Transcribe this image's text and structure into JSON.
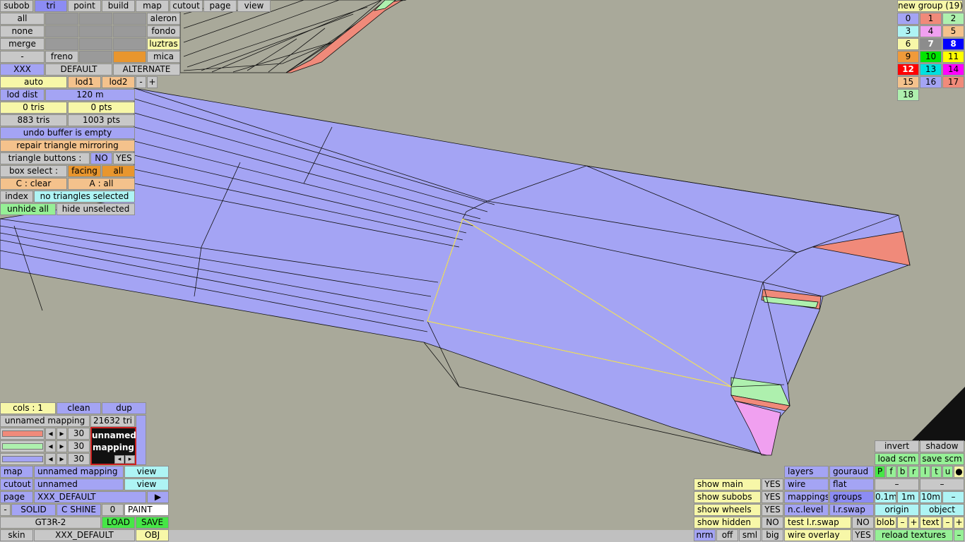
{
  "modes": {
    "subob": "subob",
    "tri": "tri",
    "point": "point",
    "build": "build",
    "map": "map",
    "cutout": "cutout",
    "page": "page",
    "view": "view"
  },
  "subob_panel": {
    "all": "all",
    "none": "none",
    "merge": "merge",
    "dash": "-",
    "aleron": "aleron",
    "fondo": "fondo",
    "luztras": "luztras",
    "freno": "freno",
    "mica": "mica",
    "xxx": "XXX",
    "default": "DEFAULT",
    "alternate": "ALTERNATE"
  },
  "lod": {
    "auto": "auto",
    "lod1": "lod1",
    "lod2": "lod2",
    "minus": "-",
    "plus": "+",
    "dist_label": "lod dist",
    "dist_value": "120 m"
  },
  "stats": {
    "sel_tris": "0 tris",
    "sel_pts": "0 pts",
    "tris": "883 tris",
    "pts": "1003 pts"
  },
  "messages": {
    "undo": "undo buffer is empty",
    "repair": "repair triangle mirroring"
  },
  "tri_buttons": {
    "label": "triangle buttons :",
    "no": "NO",
    "yes": "YES"
  },
  "box_select": {
    "label": "box select :",
    "facing": "facing",
    "all": "all"
  },
  "clear_all": {
    "clear": "C : clear",
    "all": "A : all"
  },
  "index": {
    "label": "index",
    "status": "no triangles selected"
  },
  "unhide": {
    "unhide": "unhide all",
    "hide": "hide unselected"
  },
  "groups": {
    "title": "new group (19)",
    "items": [
      "0",
      "1",
      "2",
      "3",
      "4",
      "5",
      "6",
      "7",
      "8",
      "9",
      "10",
      "11",
      "12",
      "13",
      "14",
      "15",
      "16",
      "17",
      "18"
    ],
    "colors": [
      "#a4a4f4",
      "#f08a7a",
      "#aef0ae",
      "#aef4f4",
      "#f0a0f0",
      "#f4c28c",
      "#f7f7a8",
      "#8c8c8c",
      "#0000ff",
      "#f09a3a",
      "#00e600",
      "#ffff00",
      "#ff0000",
      "#00e0e0",
      "#ff00ff",
      "#f4c28c",
      "#a4a4f4",
      "#f08a7a",
      "#aef0ae"
    ]
  },
  "mapping": {
    "cols": "cols : 1",
    "clean": "clean",
    "dup": "dup",
    "name": "unnamed mapping",
    "tri_count": "21632 tri",
    "values": [
      "30",
      "30",
      "30"
    ],
    "preview": "unnamed mapping",
    "map_label": "map",
    "map_value": "unnamed mapping",
    "view1": "view",
    "cutout_label": "cutout",
    "cutout_value": "unnamed",
    "view2": "view",
    "page_label": "page",
    "page_value": "XXX_DEFAULT",
    "page_arrow": "▶",
    "dash": "-",
    "solid": "SOLID",
    "cshine": "C SHINE",
    "zero": "0",
    "paint": "PAINT",
    "model": "GT3R-2",
    "load": "LOAD",
    "save": "SAVE",
    "skin_label": "skin",
    "skin_value": "XXX_DEFAULT",
    "obj": "OBJ"
  },
  "display": {
    "show_main": "show main",
    "show_main_v": "YES",
    "show_subobs": "show subobs",
    "show_subobs_v": "YES",
    "show_wheels": "show wheels",
    "show_wheels_v": "YES",
    "show_hidden": "show hidden",
    "show_hidden_v": "NO",
    "layers": "layers",
    "gouraud": "gouraud",
    "wire": "wire",
    "flat": "flat",
    "mappings": "mappings",
    "groups": "groups",
    "nclevel": "n.c.level",
    "lrswap": "l.r.swap",
    "test_lrswap": "test l.r.swap",
    "test_v": "NO",
    "wire_overlay": "wire overlay",
    "wire_overlay_v": "YES",
    "nrm": "nrm",
    "off": "off",
    "sml": "sml",
    "big": "big",
    "invert": "invert",
    "shadow": "shadow",
    "load_scm": "load scm",
    "save_scm": "save scm",
    "flags": [
      "P",
      "f",
      "b",
      "r",
      "l",
      "t",
      "u",
      "●"
    ],
    "d1": "–",
    "d2": "–",
    "s01": "0.1m",
    "s1": "1m",
    "s10": "10m",
    "sdash": "–",
    "origin": "origin",
    "object": "object",
    "blob": "blob",
    "bm": "–",
    "bp": "+",
    "text": "text",
    "tm": "–",
    "tp": "+",
    "reload": "reload textures",
    "rm": "–"
  }
}
